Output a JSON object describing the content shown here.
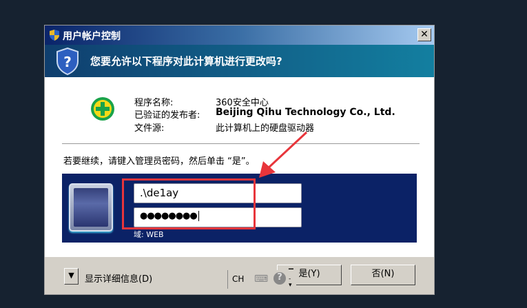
{
  "window": {
    "title": "用户帐户控制",
    "close": "✕"
  },
  "header": {
    "question": "您要允许以下程序对此计算机进行更改吗?"
  },
  "program": {
    "name_label": "程序名称:",
    "name_value": "360安全中心",
    "publisher_label": "已验证的发布者:",
    "publisher_value": "Beijing Qihu Technology Co., Ltd.",
    "source_label": "文件源:",
    "source_value": "此计算机上的硬盘驱动器"
  },
  "instruction": "若要继续，请键入管理员密码，然后单击 “是”。",
  "credentials": {
    "username": ".\\de1ay",
    "password": "●●●●●●●●",
    "domain": "域: WEB"
  },
  "footer": {
    "details": "显示详细信息(D)",
    "lang": "CH",
    "yes": "是(Y)",
    "no": "否(N)"
  },
  "colors": {
    "annotation": "#e8353b",
    "panel": "#0b2266"
  }
}
